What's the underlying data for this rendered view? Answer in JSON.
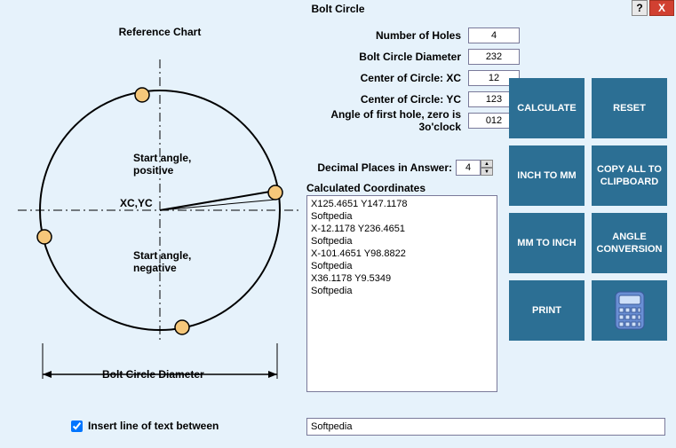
{
  "title": "Bolt Circle",
  "help_label": "?",
  "close_label": "X",
  "chart": {
    "title": "Reference Chart",
    "center_label": "XC,YC",
    "start_pos_label": "Start angle,\npositive",
    "start_neg_label": "Start angle,\nnegative",
    "diameter_label": "Bolt Circle Diameter"
  },
  "fields": {
    "num_holes": {
      "label": "Number of Holes",
      "value": "4"
    },
    "bc_diameter": {
      "label": "Bolt Circle Diameter",
      "value": "232"
    },
    "center_xc": {
      "label": "Center of Circle: XC",
      "value": "12"
    },
    "center_yc": {
      "label": "Center of Circle: YC",
      "value": "123"
    },
    "angle_first": {
      "label": "Angle of first hole, zero is 3o'clock",
      "value": "012"
    }
  },
  "decimal": {
    "label": "Decimal Places in Answer:",
    "value": "4"
  },
  "calc_coords_label": "Calculated Coordinates",
  "results": "X125.4651 Y147.1178\nSoftpedia\nX-12.1178 Y236.4651\nSoftpedia\nX-101.4651 Y98.8822\nSoftpedia\nX36.1178 Y9.5349\nSoftpedia",
  "buttons": {
    "calculate": "CALCULATE",
    "reset": "RESET",
    "inch_to_mm": "INCH TO MM",
    "copy_all": "COPY ALL TO CLIPBOARD",
    "mm_to_inch": "MM TO INCH",
    "angle_conv": "ANGLE CONVERSION",
    "print": "PRINT"
  },
  "insert": {
    "label": "Insert line of text between",
    "checked": true,
    "value": "Softpedia"
  }
}
